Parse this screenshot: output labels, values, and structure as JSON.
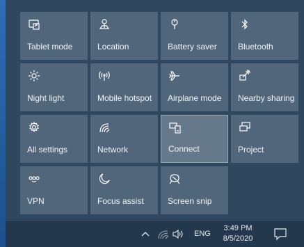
{
  "tiles": [
    {
      "label": "Tablet mode",
      "icon": "tablet-mode-icon"
    },
    {
      "label": "Location",
      "icon": "location-icon"
    },
    {
      "label": "Battery saver",
      "icon": "battery-saver-icon"
    },
    {
      "label": "Bluetooth",
      "icon": "bluetooth-icon"
    },
    {
      "label": "Night light",
      "icon": "night-light-icon"
    },
    {
      "label": "Mobile hotspot",
      "icon": "mobile-hotspot-icon"
    },
    {
      "label": "Airplane mode",
      "icon": "airplane-icon"
    },
    {
      "label": "Nearby sharing",
      "icon": "nearby-sharing-icon"
    },
    {
      "label": "All settings",
      "icon": "gear-icon"
    },
    {
      "label": "Network",
      "icon": "network-icon"
    },
    {
      "label": "Connect",
      "icon": "connect-icon"
    },
    {
      "label": "Project",
      "icon": "project-icon"
    },
    {
      "label": "VPN",
      "icon": "vpn-icon"
    },
    {
      "label": "Focus assist",
      "icon": "moon-icon"
    },
    {
      "label": "Screen snip",
      "icon": "screen-snip-icon"
    }
  ],
  "taskbar": {
    "language": "ENG",
    "time": "3:49 PM",
    "date": "8/5/2020"
  },
  "colors": {
    "tile": "#51667a",
    "tile_highlight": "#66798b",
    "panel": "#2f4860",
    "taskbar": "#24384d"
  }
}
